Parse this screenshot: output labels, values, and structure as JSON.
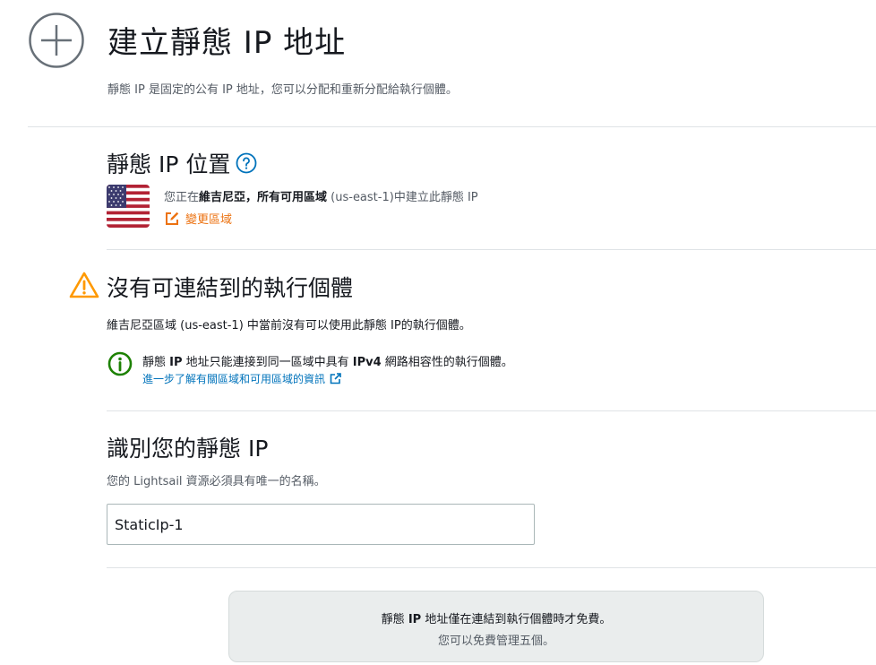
{
  "header": {
    "title": "建立靜態 IP 地址",
    "description": "靜態 IP 是固定的公有 IP 地址，您可以分配和重新分配給執行個體。"
  },
  "location": {
    "title": "靜態 IP 位置",
    "text_prefix": "您正在",
    "text_region": "維吉尼亞，所有可用區域",
    "text_code": " (us-east-1)",
    "text_suffix": "中建立此靜態 IP",
    "change_region_label": "變更區域"
  },
  "no_instances": {
    "title": "沒有可連結到的執行個體",
    "description": "維吉尼亞區域 (us-east-1) 中當前沒有可以使用此靜態 IP的執行個體。",
    "info_part1": "靜態 ",
    "info_bold1": "IP",
    "info_part2": " 地址只能連接到同一區域中具有 ",
    "info_bold2": "IPv4",
    "info_part3": " 網路相容性的執行個體。",
    "learn_more_link": "進一步了解有關區域和可用區域的資訊"
  },
  "identify": {
    "title": "識別您的靜態 IP",
    "description": "您的 Lightsail 資源必須具有唯一的名稱。",
    "name_value": "StaticIp-1"
  },
  "pricing_box": {
    "line1_part1": "靜態 ",
    "line1_bold": "IP",
    "line1_part2": " 地址僅在連結到執行個體時才免費。",
    "line2": "您可以免費管理五個。"
  },
  "colors": {
    "accent_orange": "#ec7211",
    "link_blue": "#0073bb",
    "success_green": "#1d8102",
    "warning_orange": "#ff9900"
  }
}
